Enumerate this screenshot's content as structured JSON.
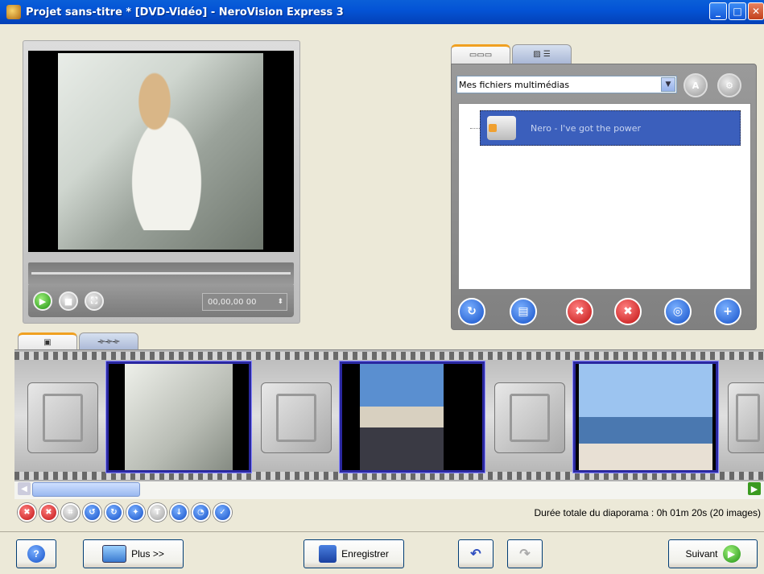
{
  "window": {
    "title": "Projet sans-titre * [DVD-Vidéo] - NeroVision Express 3",
    "min_icon": "minimize-icon",
    "max_icon": "maximize-icon",
    "close_icon": "close-icon"
  },
  "preview": {
    "timecode": "00,00,00 00",
    "play_icon": "play-icon",
    "stop_icon": "stop-icon",
    "fullscreen_icon": "fullscreen-icon"
  },
  "browser": {
    "tabs": [
      "▭▭▭",
      "▨ ☰"
    ],
    "source_select": "Mes fichiers multimédias",
    "media_items": [
      {
        "label": "Nero - I've got the power",
        "icon": "audio-file-icon"
      }
    ]
  },
  "film_tabs": [
    "▣",
    "⟛⟛⟛"
  ],
  "status": {
    "duration": "Durée totale du diaporama : 0h 01m 20s (20 images)"
  },
  "buttons": {
    "help": "?",
    "more": "Plus >>",
    "save": "Enregistrer",
    "next": "Suivant"
  },
  "colors": {
    "titlebar": "#0454d6",
    "selection": "#3b5fbc",
    "slide_border": "#2a28a0"
  }
}
